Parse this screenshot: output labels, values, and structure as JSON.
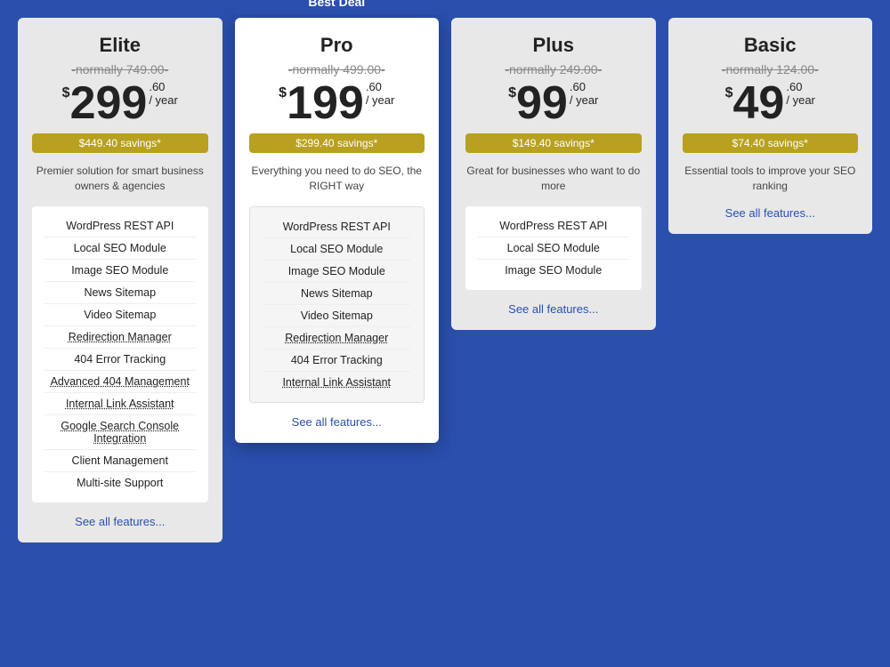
{
  "plans": [
    {
      "id": "elite",
      "name": "Elite",
      "badge": null,
      "original_price": "normally 749.00",
      "price_main": "299",
      "price_cents": ".60",
      "price_period": "/ year",
      "savings": "$449.40 savings*",
      "description": "Premier solution for smart business owners & agencies",
      "features": [
        {
          "label": "WordPress REST API",
          "underlined": false
        },
        {
          "label": "Local SEO Module",
          "underlined": false
        },
        {
          "label": "Image SEO Module",
          "underlined": false
        },
        {
          "label": "News Sitemap",
          "underlined": false
        },
        {
          "label": "Video Sitemap",
          "underlined": false
        },
        {
          "label": "Redirection Manager",
          "underlined": true
        },
        {
          "label": "404 Error Tracking",
          "underlined": false
        },
        {
          "label": "Advanced 404 Management",
          "underlined": true
        },
        {
          "label": "Internal Link Assistant",
          "underlined": true
        },
        {
          "label": "Google Search Console Integration",
          "underlined": true
        },
        {
          "label": "Client Management",
          "underlined": false
        },
        {
          "label": "Multi-site Support",
          "underlined": false
        }
      ],
      "see_all_label": "See all features..."
    },
    {
      "id": "pro",
      "name": "Pro",
      "badge": "Best Deal",
      "original_price": "normally 499.00",
      "price_main": "199",
      "price_cents": ".60",
      "price_period": "/ year",
      "savings": "$299.40 savings*",
      "description": "Everything you need to do SEO, the RIGHT way",
      "features": [
        {
          "label": "WordPress REST API",
          "underlined": false
        },
        {
          "label": "Local SEO Module",
          "underlined": false
        },
        {
          "label": "Image SEO Module",
          "underlined": false
        },
        {
          "label": "News Sitemap",
          "underlined": false
        },
        {
          "label": "Video Sitemap",
          "underlined": false
        },
        {
          "label": "Redirection Manager",
          "underlined": true
        },
        {
          "label": "404 Error Tracking",
          "underlined": false
        },
        {
          "label": "Internal Link Assistant",
          "underlined": true
        }
      ],
      "see_all_label": "See all features..."
    },
    {
      "id": "plus",
      "name": "Plus",
      "badge": null,
      "original_price": "normally 249.00",
      "price_main": "99",
      "price_cents": ".60",
      "price_period": "/ year",
      "savings": "$149.40 savings*",
      "description": "Great for businesses who want to do more",
      "features": [
        {
          "label": "WordPress REST API",
          "underlined": false
        },
        {
          "label": "Local SEO Module",
          "underlined": false
        },
        {
          "label": "Image SEO Module",
          "underlined": false
        }
      ],
      "see_all_label": "See all features..."
    },
    {
      "id": "basic",
      "name": "Basic",
      "badge": null,
      "original_price": "normally 124.00",
      "price_main": "49",
      "price_cents": ".60",
      "price_period": "/ year",
      "savings": "$74.40 savings*",
      "description": "Essential tools to improve your SEO ranking",
      "features": [],
      "see_all_label": "See all features..."
    }
  ]
}
